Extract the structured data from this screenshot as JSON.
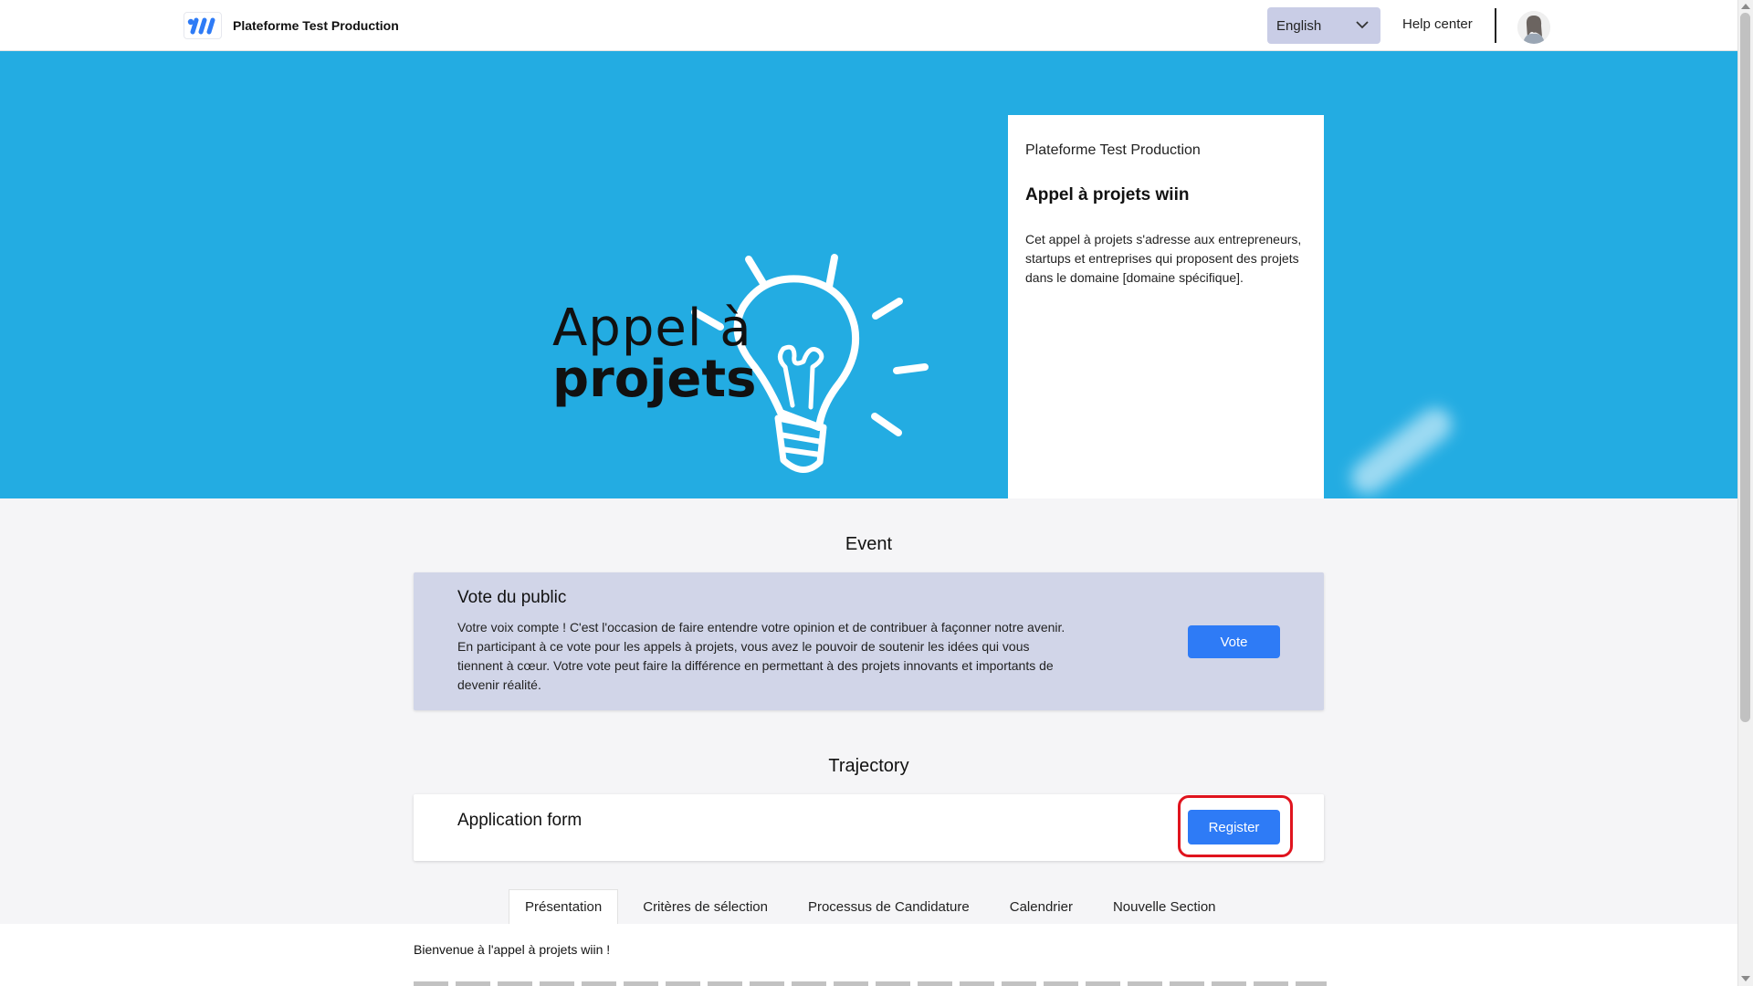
{
  "header": {
    "brand_name": "Plateforme Test Production",
    "language": "English",
    "help_center": "Help center"
  },
  "hero": {
    "image_text_line1": "Appel à",
    "image_text_line2": "projets",
    "card": {
      "organization": "Plateforme Test Production",
      "title": "Appel à projets wiin",
      "description": "Cet appel à projets s'adresse aux entrepreneurs, startups et entreprises qui proposent des projets dans le domaine [domaine spécifique]."
    }
  },
  "event_section": {
    "heading": "Event",
    "card": {
      "title": "Vote du public",
      "text": "Votre voix compte ! C'est l'occasion de faire entendre votre opinion et de contribuer à façonner notre avenir. En participant à ce vote pour les appels à projets, vous avez le pouvoir de soutenir les idées qui vous tiennent à cœur. Votre vote peut faire la différence en permettant à des projets innovants et importants de devenir réalité.",
      "button": "Vote"
    }
  },
  "trajectory_section": {
    "heading": "Trajectory",
    "card": {
      "title": "Application form",
      "button": "Register"
    }
  },
  "tabs": [
    {
      "label": "Présentation",
      "active": true
    },
    {
      "label": "Critères de sélection",
      "active": false
    },
    {
      "label": "Processus de Candidature",
      "active": false
    },
    {
      "label": "Calendrier",
      "active": false
    },
    {
      "label": "Nouvelle Section",
      "active": false
    }
  ],
  "tab_content": {
    "intro": "Bienvenue à l'appel à projets wiin !"
  },
  "colors": {
    "hero_bg": "#23ace2",
    "primary_button": "#2e7bf6",
    "event_card_bg": "#d1d5e8",
    "highlight": "#e0141e"
  }
}
